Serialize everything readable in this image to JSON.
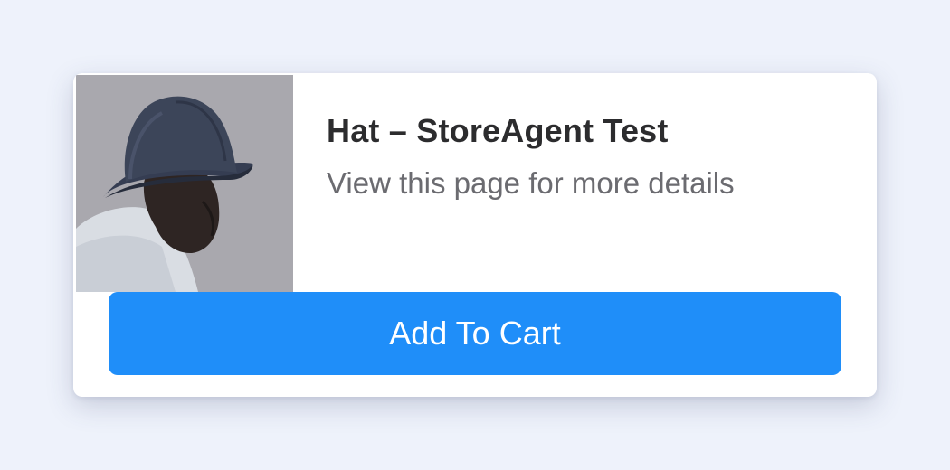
{
  "product": {
    "title": "Hat – StoreAgent Test",
    "subtitle": "View this page for more details",
    "image_icon": "product-photo"
  },
  "actions": {
    "add_to_cart_label": "Add To Cart"
  },
  "colors": {
    "page_background": "#eef2fb",
    "card_background": "#ffffff",
    "button_background": "#1f8ef9",
    "button_text": "#ffffff",
    "title_text": "#2c2c2e",
    "subtitle_text": "#6b6b70"
  }
}
